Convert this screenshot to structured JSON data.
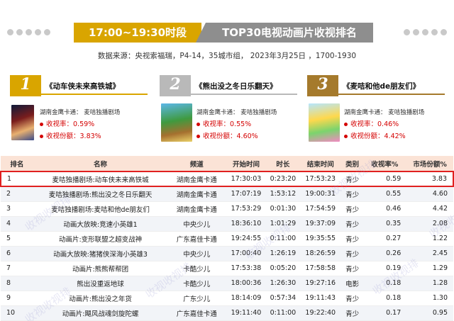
{
  "header": {
    "time_slot": "17:00~19:30时段",
    "title": "TOP30电视动画片收视排名",
    "source": "数据来源：央视索福瑞，P4-14，35城市组，  2023年3月25日 ，1700-1930"
  },
  "top3": [
    {
      "rank": "1",
      "title": "《动车侠未来高铁城》",
      "channel": "湖南金鹰卡通：   麦咭独播剧场",
      "rating_label": "收视率：",
      "rating": "0.59%",
      "share_label": "收视份额：",
      "share": "3.83%",
      "poster_icon": "poster-image"
    },
    {
      "rank": "2",
      "title": "《熊出没之冬日乐翻天》",
      "channel": "湖南金鹰卡通：   麦咭独播剧场",
      "rating_label": "收视率：",
      "rating": "0.55%",
      "share_label": "收视份额：",
      "share": "4.60%",
      "poster_icon": "poster-image"
    },
    {
      "rank": "3",
      "title": "《麦咭和他de朋友们》",
      "channel": "湖南金鹰卡通：   麦咭独播剧场",
      "rating_label": "收视率：",
      "rating": "0.46%",
      "share_label": "收视份额：",
      "share": "4.42%",
      "poster_icon": "poster-image"
    }
  ],
  "table": {
    "headers": [
      "排名",
      "名称",
      "频道",
      "开始时间",
      "时长",
      "结束时间",
      "类别",
      "收视率%",
      "市场份额%"
    ]
  },
  "chart_data": {
    "type": "table",
    "columns": [
      "排名",
      "名称",
      "频道",
      "开始时间",
      "时长",
      "结束时间",
      "类别",
      "收视率%",
      "市场份额%"
    ],
    "rows": [
      [
        "1",
        "麦咭独播剧场:动车侠未来高铁城",
        "湖南金鹰卡通",
        "17:30:03",
        "0:23:20",
        "17:53:23",
        "青少",
        "0.59",
        "3.83"
      ],
      [
        "2",
        "麦咭独播剧场:熊出没之冬日乐翻天",
        "湖南金鹰卡通",
        "17:07:19",
        "1:53:12",
        "19:00:31",
        "青少",
        "0.55",
        "4.60"
      ],
      [
        "3",
        "麦咭独播剧场:麦咭和他de朋友们",
        "湖南金鹰卡通",
        "17:53:29",
        "0:01:30",
        "17:54:59",
        "青少",
        "0.46",
        "4.42"
      ],
      [
        "4",
        "动画大放映:竞速小英雄1",
        "中央少儿",
        "18:36:10",
        "1:01:29",
        "19:37:09",
        "青少",
        "0.35",
        "2.08"
      ],
      [
        "5",
        "动画片:变形联盟之超变战神",
        "广东嘉佳卡通",
        "19:24:55",
        "0:11:00",
        "19:35:55",
        "青少",
        "0.27",
        "1.22"
      ],
      [
        "6",
        "动画大放映:猪猪侠深海小英雄3",
        "中央少儿",
        "17:00:40",
        "1:26:19",
        "18:26:59",
        "青少",
        "0.26",
        "2.45"
      ],
      [
        "7",
        "动画片:熊熊帮帮团",
        "卡酷少儿",
        "17:53:38",
        "0:05:20",
        "17:58:58",
        "青少",
        "0.19",
        "1.29"
      ],
      [
        "8",
        "熊出没重返地球",
        "卡酷少儿",
        "18:00:36",
        "1:26:30",
        "19:27:16",
        "电影",
        "0.18",
        "1.28"
      ],
      [
        "9",
        "动画片:熊出没之年货",
        "广东少儿",
        "18:14:09",
        "0:57:34",
        "19:11:43",
        "青少",
        "0.18",
        "1.30"
      ],
      [
        "10",
        "动画片:飓风战魂剑旋陀螺",
        "广东嘉佳卡通",
        "19:11:40",
        "0:11:00",
        "19:22:40",
        "青少",
        "0.17",
        "0.95"
      ]
    ]
  },
  "watermark": "收视收视排"
}
